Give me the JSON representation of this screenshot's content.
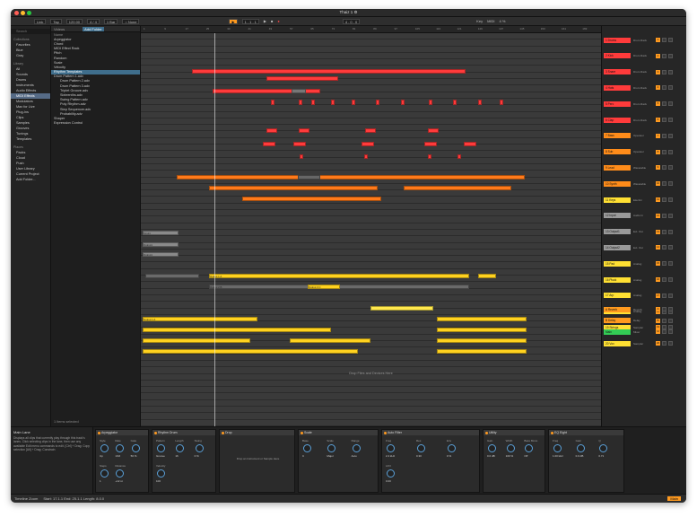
{
  "window": {
    "title": "Thaiz 1 ⚙︎"
  },
  "control_bar": {
    "link": "Link",
    "tap": "Tap",
    "tempo": "120.00",
    "meter": "4 / 4",
    "quantize": "1 Bar",
    "key_mode": "○ None",
    "position": "1 . 1 . 1",
    "loop_length": "4 . 0 . 0",
    "key_label": "Key",
    "midi_label": "MIDI",
    "cpu": "4 %"
  },
  "browser": {
    "search_placeholder": "Search",
    "collections_header": "Collections",
    "collections": [
      "Favorites",
      "Blue",
      "Gray"
    ],
    "library_header": "Library",
    "library": [
      "All",
      "Sounds",
      "Drums",
      "Instruments",
      "Audio Effects",
      "MIDI Effects",
      "Modulators",
      "Max for Live",
      "Plug-Ins",
      "Clips",
      "Samples",
      "Grooves",
      "Tunings",
      "Templates"
    ],
    "library_selected": "MIDI Effects",
    "places_header": "Places",
    "places": [
      "Packs",
      "Cloud",
      "Push",
      "User Library",
      "Current Project",
      "Add Folder..."
    ],
    "list_header": "Name",
    "list_tabs": [
      "Videos",
      "Add Folder"
    ],
    "list": [
      "Arpeggiator",
      "Chord",
      "MIDI Effect Rack",
      "Pitch",
      "Random",
      "Scale",
      "Velocity",
      "Rhythm Templates",
      "Drum Pattern 1.adv",
      "Drum Pattern 2.adv",
      "Drum Pattern 3.adv",
      "Triplet Groove.adv",
      "Sixteenths.adv",
      "Swing Pattern.adv",
      "Poly Rhythm.adv",
      "Step Sequencer.adv",
      "Probability.adv",
      "Shaper",
      "Expression Control"
    ],
    "list_selected": "Rhythm Templates",
    "footer": "1 Items selected"
  },
  "ruler": {
    "bars": [
      "1",
      "9",
      "17",
      "25",
      "33",
      "41",
      "49",
      "57",
      "65",
      "73",
      "81",
      "89",
      "97",
      "105",
      "113",
      "121",
      "129",
      "137",
      "145",
      "153",
      "161",
      "169"
    ]
  },
  "clips": {
    "track_a": "Output 1 A",
    "track_b": "Output 2 B",
    "track_c": "Output 3 C",
    "lane_1": "Input1",
    "lane_2": "Output1",
    "lane_3": "Output1",
    "drop_hint": "Drop Files and Devices Here"
  },
  "tracks": [
    {
      "name": "1 Drums",
      "device": "Drum Rack",
      "color": "#ff3b3b",
      "num": "1"
    },
    {
      "name": "2 Kick",
      "device": "Drum Rack",
      "color": "#ff3b3b",
      "num": "2"
    },
    {
      "name": "3 Snare",
      "device": "Drum Rack",
      "color": "#ff3b3b",
      "num": "3"
    },
    {
      "name": "4 Hats",
      "device": "Drum Rack",
      "color": "#ff3b3b",
      "num": "4"
    },
    {
      "name": "5 Perc",
      "device": "Drum Rack",
      "color": "#ff3b3b",
      "num": "5"
    },
    {
      "name": "6 Clap",
      "device": "Drum Rack",
      "color": "#ff3b3b",
      "num": "6"
    },
    {
      "name": "7 Bass",
      "device": "Operator",
      "color": "#ff8c1a",
      "num": "7"
    },
    {
      "name": "8 Sub",
      "device": "Operator",
      "color": "#ff8c1a",
      "num": "8"
    },
    {
      "name": "9 Lead",
      "device": "Wavetable",
      "color": "#ff8c1a",
      "num": "9"
    },
    {
      "name": "10 Synth",
      "device": "Wavetable",
      "color": "#ff8c1a",
      "num": "10"
    },
    {
      "name": "11 Keys",
      "device": "Electric",
      "color": "#ffe033",
      "num": "11"
    },
    {
      "name": "12 Input",
      "device": "Audio In",
      "color": "#9a9a9a",
      "num": "12"
    },
    {
      "name": "13 Output1",
      "device": "Ext. Out",
      "color": "#9a9a9a",
      "num": "13"
    },
    {
      "name": "14 Output2",
      "device": "Ext. Out",
      "color": "#9a9a9a",
      "num": "14"
    },
    {
      "name": "15 Pad",
      "device": "Analog",
      "color": "#ffe033",
      "num": "15"
    },
    {
      "name": "16 Pluck",
      "device": "Analog",
      "color": "#ffe033",
      "num": "16"
    },
    {
      "name": "17 Arp",
      "device": "Analog",
      "color": "#ffe033",
      "num": "17"
    },
    {
      "name": "18 Chords",
      "device": "Analog",
      "color": "#ffe033",
      "num": "18"
    },
    {
      "name": "19 Strings",
      "device": "Sampler",
      "color": "#ffe033",
      "num": "19"
    },
    {
      "name": "20 Vox",
      "device": "Sampler",
      "color": "#ffe033",
      "num": "20"
    },
    {
      "name": "A Reverb",
      "device": "Reverb",
      "color": "#ff9a1f",
      "num": "A"
    },
    {
      "name": "B Delay",
      "device": "Delay",
      "color": "#ff9a1f",
      "num": "B"
    },
    {
      "name": "Main",
      "device": "Mixer",
      "color": "#33cc55",
      "num": "M"
    }
  ],
  "info": {
    "title": "Main Lane",
    "body": "Displays all clips that currently play through this track's lanes. Click selecting clips in the lane, then use any available Edit menu commands to edit. [Ctrl] + Drag: Copy selection [Alt] + Drag: Constrain"
  },
  "devices": [
    {
      "name": "Arpeggiator",
      "params": [
        "Style",
        "Rate",
        "Gate",
        "Steps",
        "Distance"
      ],
      "values": [
        "Up",
        "1/16",
        "50 %",
        "1",
        "+12 st"
      ]
    },
    {
      "name": "Rhythm Drum",
      "params": [
        "Pattern",
        "Length",
        "Swing",
        "Velocity"
      ],
      "values": [
        "Groove",
        "16",
        "0 %",
        "100"
      ]
    },
    {
      "name": "Drop",
      "params": [
        "Drop an Instrument or Sample Here"
      ],
      "values": [
        ""
      ]
    },
    {
      "name": "Scale",
      "params": [
        "Base",
        "Scale",
        "Range"
      ],
      "values": [
        "C",
        "Major",
        "Auto"
      ]
    },
    {
      "name": "Auto Filter",
      "params": [
        "Freq",
        "Res",
        "Env",
        "LFO"
      ],
      "values": [
        "2.4 kHz",
        "0.30",
        "0 %",
        "0.00"
      ]
    },
    {
      "name": "Utility",
      "params": [
        "Gain",
        "Width",
        "Bass Mono"
      ],
      "values": [
        "0.0 dB",
        "100 %",
        "Off"
      ]
    },
    {
      "name": "EQ Eight",
      "params": [
        "Freq",
        "Gain",
        "Q"
      ],
      "values": [
        "1.00 kHz",
        "0.0 dB",
        "0.71"
      ]
    }
  ],
  "status": {
    "left": "Timeline Zoom",
    "mid": "Start: 17.1.1   End: 25.1.1   Length: 8.0.0",
    "right": "Main"
  }
}
